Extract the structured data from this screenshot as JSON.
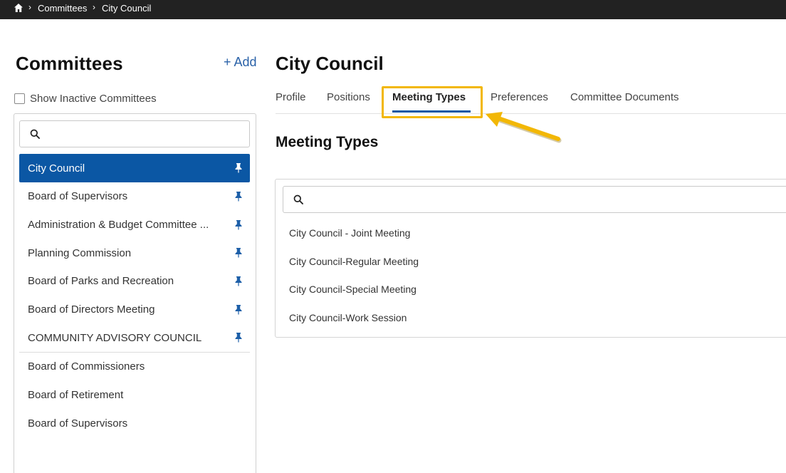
{
  "breadcrumb": {
    "items": [
      "Committees",
      "City Council"
    ]
  },
  "sidebar": {
    "title": "Committees",
    "add_label": "+ Add",
    "show_inactive_label": "Show Inactive Committees",
    "pinned_items": [
      "City Council",
      "Board of Supervisors",
      "Administration & Budget Committee ...",
      "Planning Commission",
      "Board of Parks and Recreation",
      "Board of Directors Meeting",
      "COMMUNITY ADVISORY COUNCIL"
    ],
    "other_items": [
      "Board of Commissioners",
      "Board of Retirement",
      "Board of Supervisors"
    ]
  },
  "main": {
    "title": "City Council",
    "tabs": [
      "Profile",
      "Positions",
      "Meeting Types",
      "Preferences",
      "Committee Documents"
    ],
    "active_tab": "Meeting Types",
    "section_title": "Meeting Types",
    "meeting_types": [
      "City Council - Joint Meeting",
      "City Council-Regular Meeting",
      "City Council-Special Meeting",
      "City Council-Work Session"
    ]
  },
  "colors": {
    "topbar": "#222222",
    "accent": "#0b57a4",
    "highlight": "#f2b705",
    "link": "#2a62a8"
  }
}
